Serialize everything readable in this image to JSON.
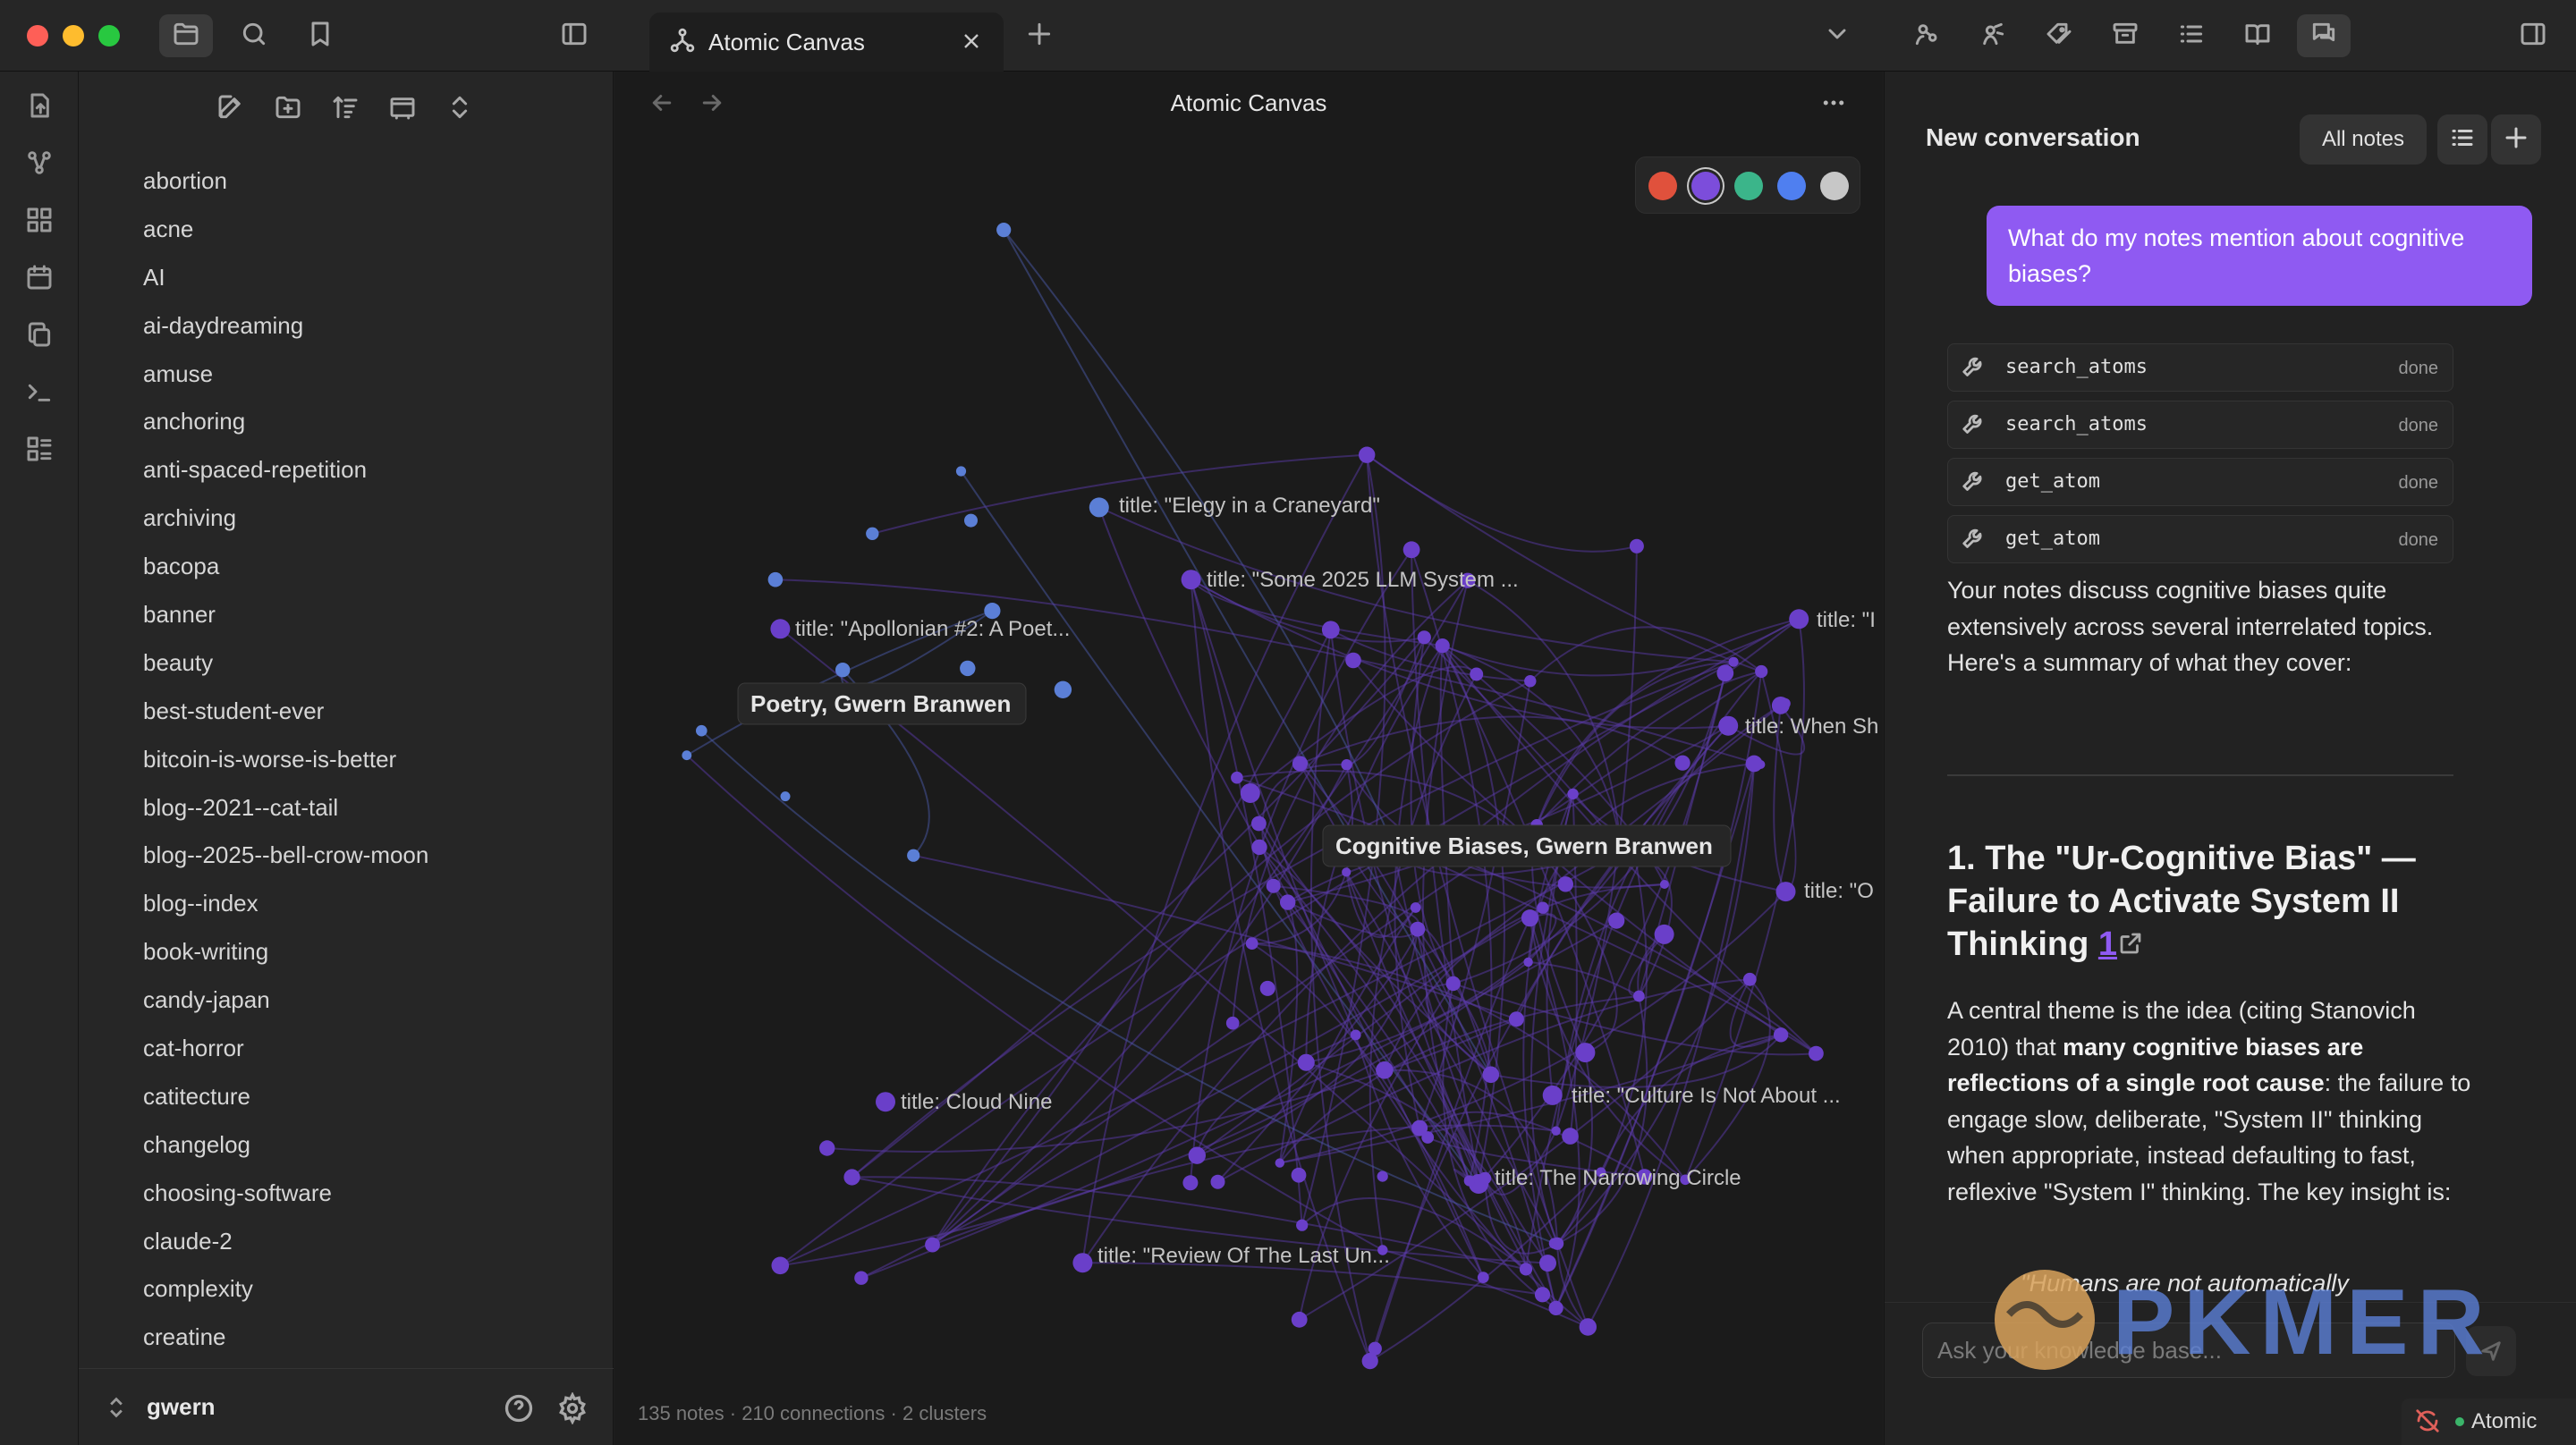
{
  "window": {
    "tab_title": "Atomic Canvas"
  },
  "titlebar": {
    "icons": [
      "files-icon",
      "search-icon",
      "bookmark-icon",
      "sidebar-left-icon",
      "plus-icon",
      "chevron-down-icon",
      "graph-a-icon",
      "graph-b-icon",
      "tags-icon",
      "archive-icon",
      "list-icon",
      "book-open-icon",
      "chat-icon",
      "sidebar-right-icon"
    ]
  },
  "ribbon": {
    "icons": [
      "open-file-icon",
      "graph-view-icon",
      "canvas-icon",
      "calendar-icon",
      "copy-icon",
      "terminal-icon",
      "templates-icon"
    ]
  },
  "explorer": {
    "folders": [
      "abortion",
      "acne",
      "AI",
      "ai-daydreaming",
      "amuse",
      "anchoring",
      "anti-spaced-repetition",
      "archiving",
      "bacopa",
      "banner",
      "beauty",
      "best-student-ever",
      "bitcoin-is-worse-is-better",
      "blog--2021--cat-tail",
      "blog--2025--bell-crow-moon",
      "blog--index",
      "book-writing",
      "candy-japan",
      "cat-horror",
      "catitecture",
      "changelog",
      "choosing-software",
      "claude-2",
      "complexity",
      "creatine"
    ],
    "vault_name": "gwern"
  },
  "canvas": {
    "title": "Atomic Canvas",
    "footer": "135 notes · 210 connections · 2 clusters",
    "swatches": [
      "#e0513c",
      "#7c4ddb",
      "#3bb58a",
      "#4f7ff0",
      "#c7c7c7"
    ],
    "selected_swatch": 1,
    "cluster_labels": [
      "Poetry, Gwern Branwen",
      "Cognitive Biases, Gwern Branwen"
    ],
    "node_labels": [
      "title: \"Elegy in a Craneyard\"",
      "title: \"Some 2025 LLM System ...",
      "title: \"Apollonian #2: A Poet...",
      "title: \"I",
      "title: When Sh",
      "title: \"O",
      "title: Cloud Nine",
      "title: \"Culture Is Not About ...",
      "title: The Narrowing Circle",
      "title: \"Review Of The Last Un..."
    ],
    "node_color": "#6a3fc9",
    "poetry_node_color": "#5b7fd6"
  },
  "chat": {
    "title": "New conversation",
    "scope_label": "All notes",
    "user_message": "What do my notes mention about cognitive biases?",
    "tool_calls": [
      {
        "name": "search_atoms",
        "status": "done"
      },
      {
        "name": "search_atoms",
        "status": "done"
      },
      {
        "name": "get_atom",
        "status": "done"
      },
      {
        "name": "get_atom",
        "status": "done"
      }
    ],
    "intro": "Your notes discuss cognitive biases quite extensively across several interrelated topics. Here's a summary of what they cover:",
    "heading": "1. The \"Ur-Cognitive Bias\" — Failure to Activate System II Thinking ",
    "citation": "1",
    "body_1": "A central theme is the idea (citing Stanovich 2010) that ",
    "body_bold_1": "many cognitive biases are reflections of a single root cause",
    "body_2": ": the failure to engage slow, deliberate, \"System II\" thinking when appropriate, instead defaulting to fast, reflexive \"System I\" thinking. The key insight is:",
    "quote": "\"Humans are not automatically",
    "input_placeholder": "Ask your knowledge base...",
    "status_label": "Atomic",
    "accent": "#8f5af2",
    "status_dot": "#3bb56a"
  },
  "watermark": {
    "text": "PKMER"
  }
}
